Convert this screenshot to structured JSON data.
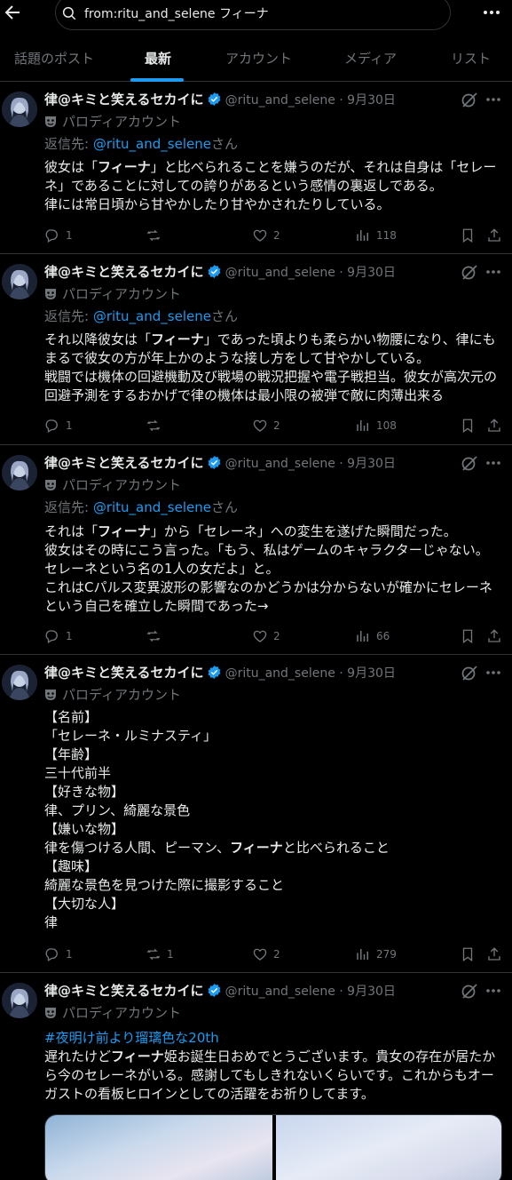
{
  "search": {
    "query": "from:ritu_and_selene フィーナ"
  },
  "tabs": [
    {
      "label": "話題のポスト"
    },
    {
      "label": "最新"
    },
    {
      "label": "アカウント"
    },
    {
      "label": "メディア"
    },
    {
      "label": "リスト"
    }
  ],
  "active_tab": "最新",
  "colors": {
    "accent": "#1d9bf0",
    "muted": "#71767b",
    "background": "#000000",
    "text": "#e7e9ea",
    "border": "#2f3336"
  },
  "posts": [
    {
      "name": "律@キミと笑えるセカイに",
      "handle": "@ritu_and_selene · 9月30日",
      "parody": "パロディアカウント",
      "reply_prefix": "返信先: ",
      "reply_handle": "@ritu_and_selene",
      "reply_suffix": "さん",
      "lines": [
        [
          "彼女は「",
          "フィーナ",
          "」と比べられることを嫌うのだが、それは自身は「セレー"
        ],
        [
          "ネ」であることに対しての誇りがあるという感情の裏返しである。"
        ],
        [
          "律には常日頃から甘やかしたり甘やかされたりしている。"
        ]
      ],
      "stats": {
        "replies": "1",
        "reposts": "",
        "likes": "2",
        "views": "118"
      }
    },
    {
      "name": "律@キミと笑えるセカイに",
      "handle": "@ritu_and_selene · 9月30日",
      "parody": "パロディアカウント",
      "reply_prefix": "返信先: ",
      "reply_handle": "@ritu_and_selene",
      "reply_suffix": "さん",
      "lines": [
        [
          "それ以降彼女は「",
          "フィーナ",
          "」であった頃よりも柔らかい物腰になり、律にも"
        ],
        [
          "まるで彼女の方が年上かのような接し方をして甘やかしている。"
        ],
        [
          "戦闘では機体の回避機動及び戦場の戦況把握や電子戦担当。彼女が高次元の"
        ],
        [
          "回避予測をするおかげで律の機体は最小限の被弾で敵に肉薄出来る"
        ]
      ],
      "stats": {
        "replies": "1",
        "reposts": "",
        "likes": "2",
        "views": "108"
      }
    },
    {
      "name": "律@キミと笑えるセカイに",
      "handle": "@ritu_and_selene · 9月30日",
      "parody": "パロディアカウント",
      "reply_prefix": "返信先: ",
      "reply_handle": "@ritu_and_selene",
      "reply_suffix": "さん",
      "lines": [
        [
          "それは「",
          "フィーナ",
          "」から「セレーネ」への変生を遂げた瞬間だった。"
        ],
        [
          "彼女はその時にこう言った。「もう、私はゲームのキャラクターじゃない。"
        ],
        [
          "セレーネという名の1人の女だよ」と。"
        ],
        [
          "これはCパルス変異波形の影響なのかどうかは分からないが確かにセレーネ"
        ],
        [
          "という自己を確立した瞬間であった→"
        ]
      ],
      "stats": {
        "replies": "1",
        "reposts": "",
        "likes": "2",
        "views": "66"
      }
    },
    {
      "name": "律@キミと笑えるセカイに",
      "handle": "@ritu_and_selene · 9月30日",
      "parody": "パロディアカウント",
      "lines": [
        [
          "【名前】"
        ],
        [
          "「セレーネ・ルミナスティ」"
        ],
        [
          "【年齢】"
        ],
        [
          "三十代前半"
        ],
        [
          "【好きな物】"
        ],
        [
          "律、プリン、綺麗な景色"
        ],
        [
          "【嫌いな物】"
        ],
        [
          "律を傷つける人間、ピーマン、",
          "フィーナ",
          "と比べられること"
        ],
        [
          "【趣味】"
        ],
        [
          "綺麗な景色を見つけた際に撮影すること"
        ],
        [
          "【大切な人】"
        ],
        [
          "律"
        ]
      ],
      "stats": {
        "replies": "1",
        "reposts": "1",
        "likes": "2",
        "views": "279"
      }
    },
    {
      "name": "律@キミと笑えるセカイに",
      "handle": "@ritu_and_selene · 9月30日",
      "parody": "パロディアカウント",
      "hashtag": "#夜明け前より瑠璃色な20th",
      "lines": [
        [
          "遅れたけど",
          "フィーナ",
          "姫お誕生日おめでとうございます。貴女の存在が居たか"
        ],
        [
          "ら今のセレーネがいる。感謝してもしきれないくらいです。これからもオー"
        ],
        [
          "ガストの看板ヒロインとしての活躍をお祈りしてます。"
        ]
      ]
    }
  ]
}
